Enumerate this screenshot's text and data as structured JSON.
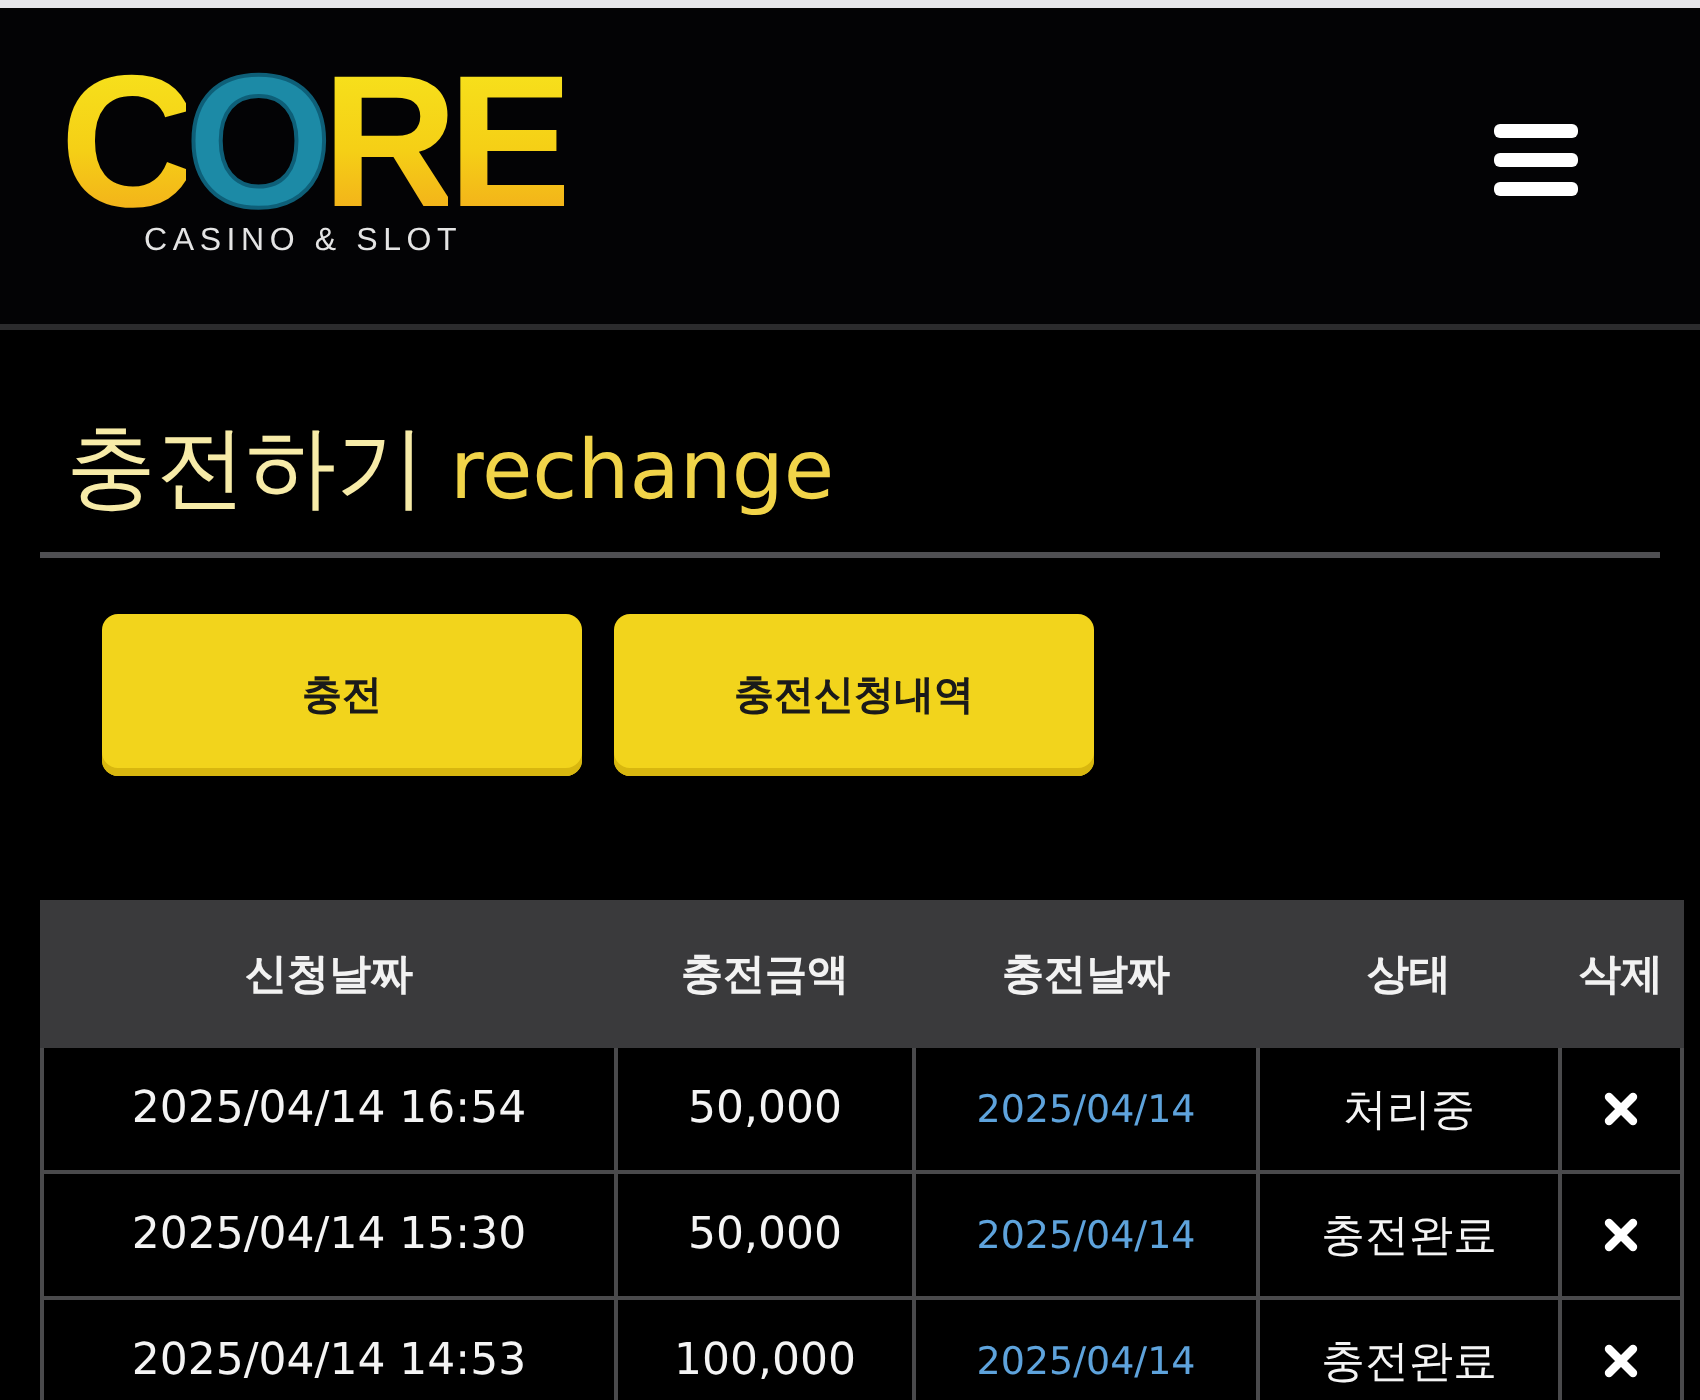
{
  "header": {
    "logo": {
      "wordmark": "CORE",
      "tagline": "CASINO & SLOT"
    }
  },
  "page": {
    "title": "충전하기",
    "subtitle": "rechange"
  },
  "buttons": [
    {
      "label": "충전"
    },
    {
      "label": "충전신청내역"
    }
  ],
  "table": {
    "columns": [
      "신청날짜",
      "충전금액",
      "충전날짜",
      "상태",
      "삭제"
    ],
    "rows": [
      {
        "requested_at": "2025/04/14 16:54",
        "amount": "50,000",
        "charged_on": "2025/04/14",
        "status": "처리중"
      },
      {
        "requested_at": "2025/04/14 15:30",
        "amount": "50,000",
        "charged_on": "2025/04/14",
        "status": "충전완료"
      },
      {
        "requested_at": "2025/04/14 14:53",
        "amount": "100,000",
        "charged_on": "2025/04/14",
        "status": "충전완료"
      }
    ]
  }
}
